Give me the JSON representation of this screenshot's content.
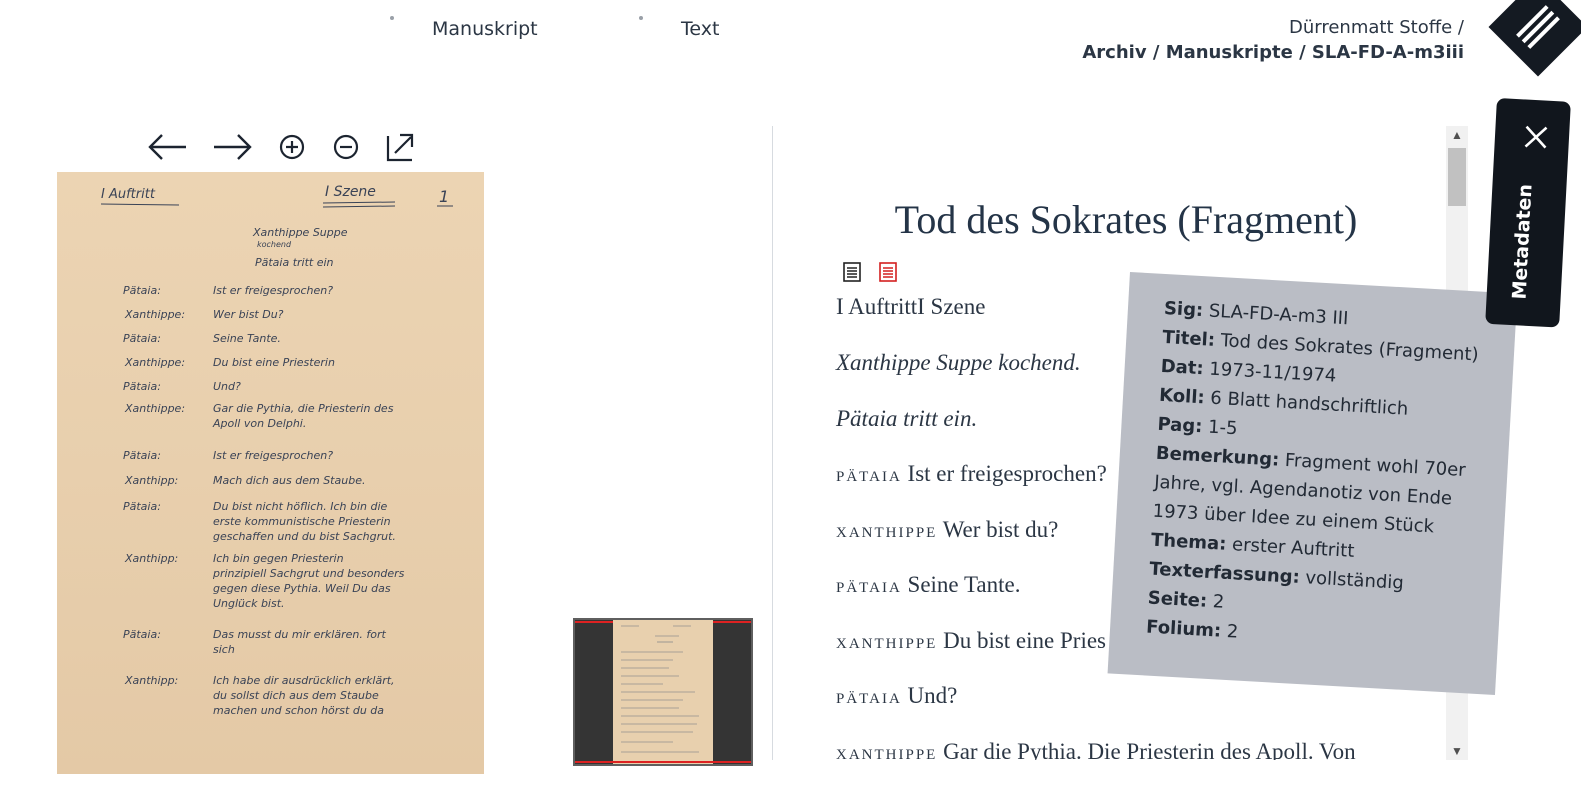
{
  "header": {
    "tabs": [
      {
        "label": "Manuskript"
      },
      {
        "label": "Text"
      }
    ],
    "breadcrumb": {
      "line1": "Dürrenmatt Stoffe /",
      "archiv": "Archiv",
      "manuskripte": "Manuskripte",
      "signature": "SLA-FD-A-m3iii",
      "sep": " / "
    },
    "menu_icon": "hamburger-menu-icon"
  },
  "toolbar": {
    "icons": [
      "arrow-left-icon",
      "arrow-right-icon",
      "zoom-in-icon",
      "zoom-out-icon",
      "external-link-icon"
    ]
  },
  "manuscript": {
    "page_number": "1",
    "heading_left": "I Auftritt",
    "heading_right": "I Szene",
    "stage_lines": [
      "Xanthippe Suppe",
      "kochend",
      "Pätaia tritt ein"
    ],
    "lines": [
      {
        "speaker": "Pätaia:",
        "text": "Ist er freigesprochen?"
      },
      {
        "speaker": "Xanthippe:",
        "text": "Wer bist Du?"
      },
      {
        "speaker": "Pätaia:",
        "text": "Seine Tante."
      },
      {
        "speaker": "Xanthippe:",
        "text": "Du bist eine Priesterin"
      },
      {
        "speaker": "Pätaia:",
        "text": "Und?"
      },
      {
        "speaker": "Xanthippe:",
        "text": "Gar die Pythia, die Priesterin des Apoll von Delphi."
      },
      {
        "speaker": "Pätaia:",
        "text": "Ist er freigesprochen?"
      },
      {
        "speaker": "Xanthipp:",
        "text": "Mach dich aus dem Staube."
      },
      {
        "speaker": "Pätaia:",
        "text": "Du bist nicht höflich. Ich bin die erste kommunistische Priesterin geschaffen und du bist Sachgrut."
      },
      {
        "speaker": "Xanthipp:",
        "text": "Ich bin gegen Priesterin prinzipiell Sachgrut und besonders gegen diese Pythia. Weil Du das Unglück bist."
      },
      {
        "speaker": "Pätaia:",
        "text": "Das musst du mir erklären. fort sich"
      },
      {
        "speaker": "Xanthipp:",
        "text": "Ich habe dir ausdrücklich erklärt, du sollst dich aus dem Staube machen und schon hörst du da"
      }
    ]
  },
  "text": {
    "title": "Tod des Sokrates (Fragment)",
    "icons": [
      "document-icon",
      "pdf-icon"
    ],
    "heading": "I AuftrittI Szene",
    "stage1": "Xanthippe Suppe kochend.",
    "stage2": "Pätaia tritt ein.",
    "dialog": [
      {
        "speaker": "PÄTAIA",
        "text": "Ist er freigesprochen?"
      },
      {
        "speaker": "XANTHIPPE",
        "text": "Wer bist du?"
      },
      {
        "speaker": "PÄTAIA",
        "text": "Seine Tante."
      },
      {
        "speaker": "XANTHIPPE",
        "text": "Du bist eine Pries"
      },
      {
        "speaker": "PÄTAIA",
        "text": "Und?"
      },
      {
        "speaker": "XANTHIPPE",
        "text": "Gar die Pythia. Die Priesterin des Apoll. Von"
      }
    ]
  },
  "metadata": {
    "tab_label": "Metadaten",
    "close_icon": "close-icon",
    "rows": [
      {
        "key": "Sig:",
        "value": "SLA-FD-A-m3 III"
      },
      {
        "key": "Titel:",
        "value": "Tod des Sokrates (Fragment)"
      },
      {
        "key": "Dat:",
        "value": "1973-11/1974"
      },
      {
        "key": "Koll:",
        "value": "6 Blatt handschriftlich"
      },
      {
        "key": "Pag:",
        "value": "1-5"
      },
      {
        "key": "Bemerkung:",
        "value": "Fragment wohl 70er Jahre, vgl. Agendanotiz von Ende 1973 über Idee zu einem Stück"
      },
      {
        "key": "Thema:",
        "value": "erster Auftritt"
      },
      {
        "key": "Texterfassung:",
        "value": "vollständig"
      },
      {
        "key": "Seite:",
        "value": "2"
      },
      {
        "key": "Folium:",
        "value": "2"
      }
    ]
  },
  "colors": {
    "text_dark": "#243447",
    "meta_bg": "#babdc5",
    "tab_bg": "#11161d",
    "pdf_red": "#d42020"
  }
}
